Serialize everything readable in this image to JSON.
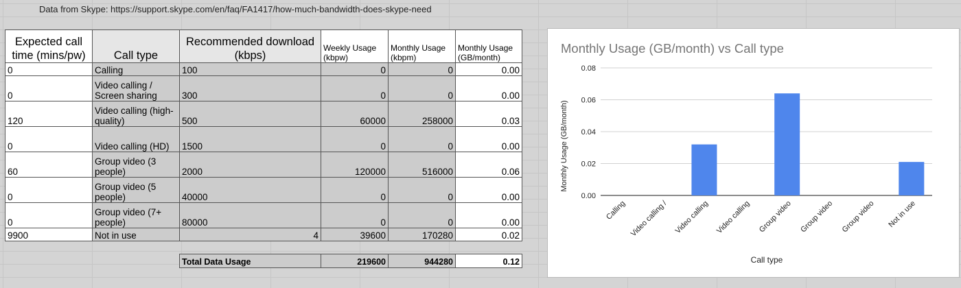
{
  "source_note": "Data from Skype: https://support.skype.com/en/faq/FA1417/how-much-bandwidth-does-skype-need",
  "table": {
    "headers": {
      "expected": "Expected call time (mins/pw)",
      "call_type": "Call type",
      "recommended": "Recommended download (kbps)",
      "weekly": "Weekly Usage (kbpw)",
      "monthly": "Monthly Usage (kbpm)",
      "monthly_gb": "Monthly Usage (GB/month)"
    },
    "rows": [
      {
        "mins": "0",
        "type": "Calling",
        "kbps": "100",
        "weekly": "0",
        "monthly": "0",
        "gb": "0.00"
      },
      {
        "mins": "0",
        "type": "Video calling / Screen sharing",
        "kbps": "300",
        "weekly": "0",
        "monthly": "0",
        "gb": "0.00"
      },
      {
        "mins": "120",
        "type": "Video calling (high-quality)",
        "kbps": "500",
        "weekly": "60000",
        "monthly": "258000",
        "gb": "0.03"
      },
      {
        "mins": "0",
        "type": "Video calling (HD)",
        "kbps": "1500",
        "weekly": "0",
        "monthly": "0",
        "gb": "0.00"
      },
      {
        "mins": "60",
        "type": "Group video (3 people)",
        "kbps": "2000",
        "weekly": "120000",
        "monthly": "516000",
        "gb": "0.06"
      },
      {
        "mins": "0",
        "type": "Group video (5 people)",
        "kbps": "40000",
        "weekly": "0",
        "monthly": "0",
        "gb": "0.00"
      },
      {
        "mins": "0",
        "type": "Group video (7+ people)",
        "kbps": "80000",
        "weekly": "0",
        "monthly": "0",
        "gb": "0.00"
      },
      {
        "mins": "9900",
        "type": "Not in use",
        "kbps": "4",
        "weekly": "39600",
        "monthly": "170280",
        "gb": "0.02"
      }
    ],
    "total": {
      "label": "Total Data Usage",
      "weekly": "219600",
      "monthly": "944280",
      "gb": "0.12"
    }
  },
  "chart_data": {
    "type": "bar",
    "title": "Monthly Usage (GB/month) vs Call type",
    "xlabel": "Call type",
    "ylabel": "Monthly Usage (GB/month)",
    "ylim": [
      0,
      0.08
    ],
    "yticks": [
      "0.00",
      "0.02",
      "0.04",
      "0.06",
      "0.08"
    ],
    "categories": [
      "Calling",
      "Video calling /",
      "Video calling",
      "Video calling",
      "Group video",
      "Group video",
      "Group video",
      "Not in use"
    ],
    "values": [
      0,
      0,
      0.032,
      0,
      0.064,
      0,
      0,
      0.021
    ],
    "bar_color": "#4f86ec",
    "grid": true,
    "legend": "none"
  }
}
